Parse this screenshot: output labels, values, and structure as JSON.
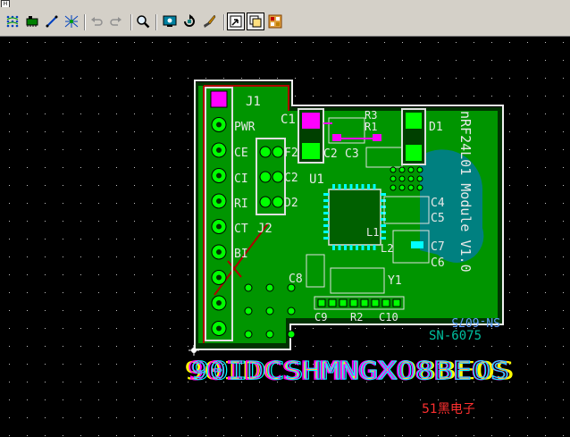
{
  "window": {
    "sys_icon": "H"
  },
  "toolbar": {
    "buttons": [
      {
        "name": "ratsnest-icon"
      },
      {
        "name": "component-icon"
      },
      {
        "name": "route-line-icon"
      },
      {
        "name": "fanout-icon"
      },
      {
        "name": "undo-icon"
      },
      {
        "name": "redo-icon"
      },
      {
        "name": "zoom-icon"
      },
      {
        "name": "view-icon"
      },
      {
        "name": "rotate-icon"
      },
      {
        "name": "brush-icon"
      },
      {
        "name": "layer-select-icon",
        "pressed": true
      },
      {
        "name": "layer-window-icon",
        "pressed": true
      },
      {
        "name": "palette-icon"
      }
    ]
  },
  "pcb": {
    "labels": {
      "j1": "J1",
      "pwr": "PWR",
      "ce": "CE",
      "ci": "CI",
      "ri": "RI",
      "ct": "CT",
      "bi": "BI",
      "f2": "F2",
      "c2a": "C2",
      "d2": "D2",
      "j2": "J2",
      "c1": "C1",
      "r3": "R3",
      "r1": "R1",
      "c2b": "C2",
      "c3": "C3",
      "u1": "U1",
      "d1": "D1",
      "c4": "C4",
      "c5": "C5",
      "l1": "L1",
      "l2": "L2",
      "c7": "C7",
      "c6": "C6",
      "c8": "C8",
      "y1": "Y1",
      "c9": "C9",
      "r2": "R2",
      "c10": "C10",
      "side": "nRF24L01 Module V1.0",
      "mirror": "SN-6075",
      "board_sn": "SN-6075",
      "garble": "90IDCSHMNGXO8BEOS",
      "watermark": "51黑电子"
    }
  },
  "colors": {
    "bg": "#000000",
    "board_outline": "#ffffff",
    "silk": "#e8e8e8",
    "copper_top": "#00c000",
    "copper_bright": "#00ff00",
    "teal": "#008080",
    "magenta": "#ff00ff",
    "red": "#c00000",
    "watermark": "#ff3030",
    "sn_text": "#00c0a0"
  }
}
